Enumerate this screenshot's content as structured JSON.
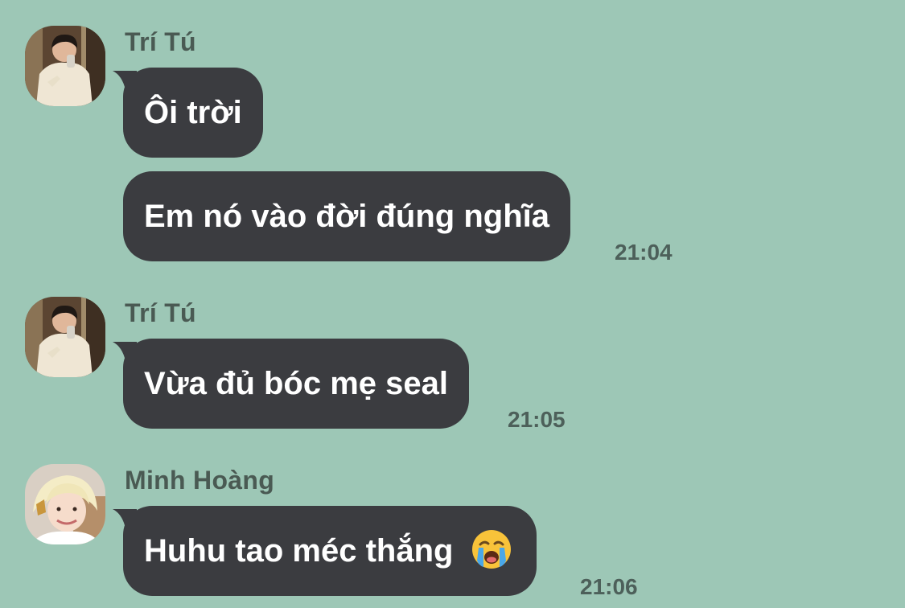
{
  "messages": [
    {
      "sender": "Trí Tú",
      "avatar": "male-user-avatar",
      "bubbles": [
        "Ôi trời",
        "Em nó vào đời đúng nghĩa"
      ],
      "time": "21:04"
    },
    {
      "sender": "Trí Tú",
      "avatar": "male-user-avatar",
      "bubbles": [
        "Vừa đủ bóc mẹ seal"
      ],
      "time": "21:05"
    },
    {
      "sender": "Minh Hoàng",
      "avatar": "blonde-user-avatar",
      "bubbles": [
        "Huhu tao méc thắng"
      ],
      "emoji": "loudly-crying-face-icon",
      "time": "21:06"
    }
  ],
  "colors": {
    "background": "#9dc7b6",
    "bubble": "#3b3c40",
    "bubble_text": "#ffffff",
    "sender_text": "#4a5a53",
    "time_text": "#4d605a"
  }
}
